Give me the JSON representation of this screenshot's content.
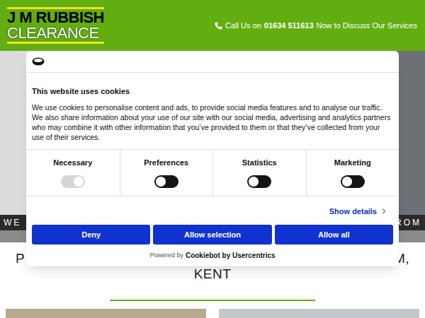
{
  "header": {
    "logo": {
      "line1": "J M RUBBISH",
      "line2": "CLEARANCE"
    },
    "phone": {
      "prefix": "Call Us on",
      "number": "01634 511613",
      "suffix": "Now to Discuss Our Services"
    }
  },
  "hero": {
    "caption_left": "WE",
    "caption_right": "ROM"
  },
  "heading": {
    "line1_left": "P",
    "line1_right": "M,",
    "line2": "KENT"
  },
  "cookie_dialog": {
    "title": "This website uses cookies",
    "text": "We use cookies to personalise content and ads, to provide social media features and to analyse our traffic. We also share information about your use of our site with our social media, advertising and analytics partners who may combine it with other information that you’ve provided to them or that they’ve collected from your use of their services.",
    "toggles": [
      {
        "label": "Necessary",
        "on": true,
        "disabled": true
      },
      {
        "label": "Preferences",
        "on": false,
        "disabled": false
      },
      {
        "label": "Statistics",
        "on": false,
        "disabled": false
      },
      {
        "label": "Marketing",
        "on": false,
        "disabled": false
      }
    ],
    "show_details": "Show details",
    "buttons": [
      "Deny",
      "Allow selection",
      "Allow all"
    ],
    "powered_by": "Powered by",
    "brand": "Cookiebot by Usercentrics"
  }
}
